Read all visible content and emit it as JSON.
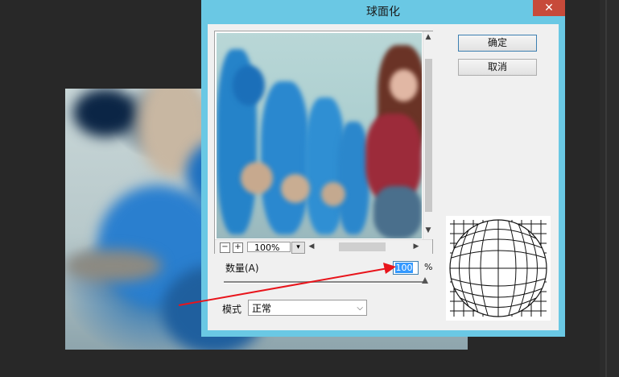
{
  "dialog": {
    "title": "球面化",
    "close_label": "✕",
    "ok_label": "确定",
    "cancel_label": "取消",
    "zoom": {
      "value": "100%",
      "minus": "−",
      "plus": "+"
    },
    "amount": {
      "label": "数量(A)",
      "value": "100",
      "unit": "%",
      "slider_fraction": 1.0
    },
    "mode": {
      "label": "模式",
      "selected": "正常"
    }
  },
  "colors": {
    "titlebar": "#6ac8e4",
    "close": "#c74a3a",
    "selection": "#3399ff",
    "annotation_arrow": "#e8141b"
  }
}
